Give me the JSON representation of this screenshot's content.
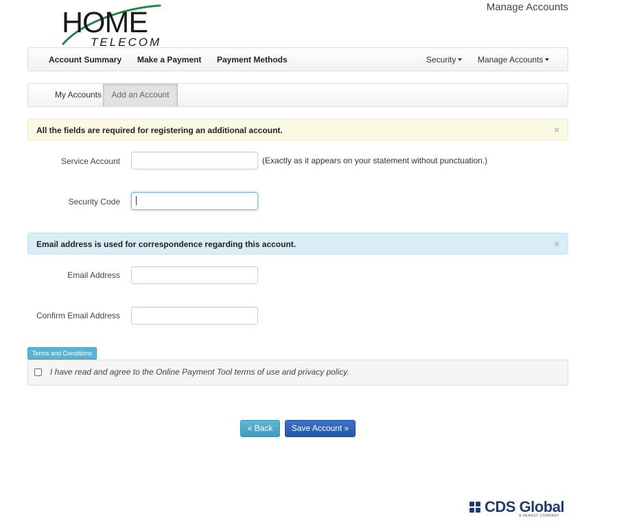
{
  "brand": {
    "logo_main": "HOME",
    "logo_sub": "TELECOM",
    "logo_colors": {
      "text": "#1a1a1a",
      "swoosh": "#1e8a4a"
    }
  },
  "header": {
    "manage_accounts_link": "Manage Accounts"
  },
  "navbar": {
    "items": [
      {
        "label": "Account Summary"
      },
      {
        "label": "Make a Payment"
      },
      {
        "label": "Payment Methods"
      }
    ],
    "right_items": [
      {
        "label": "Security",
        "icon": "caret-down-icon"
      },
      {
        "label": "Manage Accounts",
        "icon": "caret-down-icon"
      }
    ]
  },
  "tabs": {
    "items": [
      {
        "label": "My Accounts",
        "active": false
      },
      {
        "label": "Add an Account",
        "active": true
      }
    ]
  },
  "alerts": {
    "required": {
      "text": "All the fields are required for registering an additional account.",
      "close": "×",
      "color": "#fbf8e3"
    },
    "email": {
      "text": "Email address is used for correspondence regarding this account.",
      "close": "×",
      "color": "#d9edf7"
    }
  },
  "form": {
    "service_account": {
      "label": "Service Account",
      "value": "",
      "help": "(Exactly as it appears on your statement without punctuation.)"
    },
    "security_code": {
      "label": "Security Code",
      "value": "",
      "focused": true
    },
    "email": {
      "label": "Email Address",
      "value": ""
    },
    "confirm_email": {
      "label": "Confirm Email Address",
      "value": ""
    }
  },
  "terms": {
    "badge": "Terms and Conditions",
    "agree_text": "I have read and agree to the Online Payment Tool terms of use and privacy policy.",
    "checked": false
  },
  "buttons": {
    "back": "« Back",
    "save": "Save Account »",
    "colors": {
      "back": "#4aa9cb",
      "save": "#2c62b8"
    }
  },
  "footer": {
    "vendor_logo": "CDS Global",
    "vendor_sub": "A HEARST COMPANY"
  }
}
